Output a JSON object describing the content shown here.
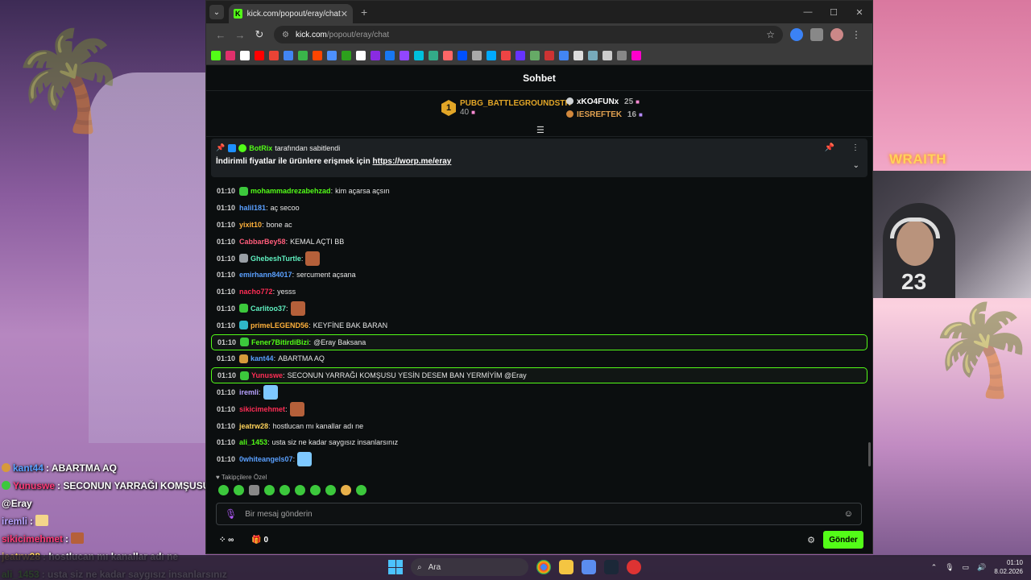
{
  "browser": {
    "tab_title": "kick.com/popout/eray/chat",
    "tab_favicon": "K",
    "url_host": "kick.com",
    "url_path": "/popout/eray/chat"
  },
  "stream_overlay": {
    "wraith_label": "WRAITH",
    "cam_shirt_number": "23",
    "lines": [
      {
        "user": "kant44",
        "user_color": "#5aa0ff",
        "text": ": ABARTMA AQ",
        "badge": "#d69a3b"
      },
      {
        "user": "Yunuswe",
        "user_color": "#ff3b7a",
        "text": ": SECONUN YARRAĞI KOMŞUSU YESİN",
        "badge": "#3cc83c"
      },
      {
        "user": "",
        "user_color": "#ffffff",
        "text": "@Eray",
        "badge": ""
      },
      {
        "user": "iremli",
        "user_color": "#b8a2ff",
        "text": ":",
        "badge": "",
        "emote": "#f3d58a"
      },
      {
        "user": "sikicimehmet",
        "user_color": "#ff3b7a",
        "text": ":",
        "badge": "",
        "emote": "#b5603a"
      },
      {
        "user": "jeatrw28",
        "user_color": "#ffd35a",
        "text": ": hostlucan mı kanallar adı ne",
        "badge": ""
      },
      {
        "user": "ali_1453",
        "user_color": "#53fc18",
        "text": ": usta siz ne kadar saygısız insanlarsınız",
        "badge": ""
      }
    ]
  },
  "chat": {
    "header": "Sohbet",
    "leaderboard": {
      "first": {
        "rank": "1",
        "name": "PUBG_BATTLEGROUNDSTR",
        "count": "40"
      },
      "second": {
        "name": "xKO4FUNx",
        "count": "25"
      },
      "third": {
        "name": "IESREFTEK",
        "count": "16"
      }
    },
    "pinned": {
      "user": "BotRix",
      "label": "tarafından sabitlendi",
      "message": "İndirimli fiyatlar ile ürünlere erişmek için ",
      "link": "https://worp.me/eray"
    },
    "messages": [
      {
        "time": "01:10",
        "user": "mohammadrezabehzad",
        "color": "#53fc18",
        "text": "kim açarsa açsın",
        "badge": "#3cc83c",
        "hl": false
      },
      {
        "time": "01:10",
        "user": "halil181",
        "color": "#5aa0ff",
        "text": "aç secoo",
        "badge": "",
        "hl": false
      },
      {
        "time": "01:10",
        "user": "yixit10",
        "color": "#ffb13b",
        "text": "bone ac",
        "badge": "",
        "hl": false
      },
      {
        "time": "01:10",
        "user": "CabbarBey58",
        "color": "#ff5c7a",
        "text": "KEMAL AÇTI BB",
        "badge": "",
        "hl": false
      },
      {
        "time": "01:10",
        "user": "GhebeshTurtle",
        "color": "#5ff0c0",
        "text": "",
        "badge": "#9aa0a6",
        "emote": "#b5603a",
        "hl": false
      },
      {
        "time": "01:10",
        "user": "emirhann84017",
        "color": "#5aa0ff",
        "text": "sercument açsana",
        "badge": "",
        "hl": false
      },
      {
        "time": "01:10",
        "user": "nacho772",
        "color": "#ff2d55",
        "text": "yesss",
        "badge": "",
        "hl": false
      },
      {
        "time": "01:10",
        "user": "Carlitoo37",
        "color": "#5ff0c0",
        "text": "",
        "badge": "#3cc83c",
        "emote": "#b5603a",
        "hl": false
      },
      {
        "time": "01:10",
        "user": "primeLEGEND56",
        "color": "#ffb13b",
        "text": "KEYFİNE BAK BARAN",
        "badge": "#2fb7c9",
        "hl": false
      },
      {
        "time": "01:10",
        "user": "Fener7BitirdiBizi",
        "color": "#53fc18",
        "text": "@Eray Baksana",
        "badge": "#3cc83c",
        "hl": true
      },
      {
        "time": "01:10",
        "user": "kant44",
        "color": "#5aa0ff",
        "text": "ABARTMA AQ",
        "badge": "#d69a3b",
        "hl": false
      },
      {
        "time": "01:10",
        "user": "Yunuswe",
        "color": "#ff2d55",
        "text": "SECONUN YARRAĞI KOMŞUSU YESİN DESEM BAN YERMİYİM @Eray",
        "badge": "#3cc83c",
        "hl": true
      },
      {
        "time": "01:10",
        "user": "iremli",
        "color": "#b8a2ff",
        "text": "",
        "badge": "",
        "emote": "#7ec8ff",
        "hl": false
      },
      {
        "time": "01:10",
        "user": "sikicimehmet",
        "color": "#ff2d55",
        "text": "",
        "badge": "",
        "emote": "#b5603a",
        "hl": false
      },
      {
        "time": "01:10",
        "user": "jeatrw28",
        "color": "#ffd35a",
        "text": "hostlucan mı kanallar adı ne",
        "badge": "",
        "hl": false
      },
      {
        "time": "01:10",
        "user": "ali_1453",
        "color": "#53fc18",
        "text": "usta siz ne kadar saygısız insanlarsınız",
        "badge": "",
        "hl": false
      },
      {
        "time": "01:10",
        "user": "0whiteangels07",
        "color": "#5aa0ff",
        "text": "",
        "badge": "",
        "emote": "#7ec8ff",
        "hl": false
      }
    ],
    "followers_label": "Takipçilere Özel",
    "input_placeholder": "Bir mesaj gönderin",
    "points": "∞",
    "gift_count": "0",
    "send_label": "Gönder"
  },
  "taskbar": {
    "search_label": "Ara",
    "time": "01:10",
    "date": "8.02.2026"
  },
  "colors": {
    "accent": "#53fc18",
    "bg": "#0b0e0f"
  }
}
